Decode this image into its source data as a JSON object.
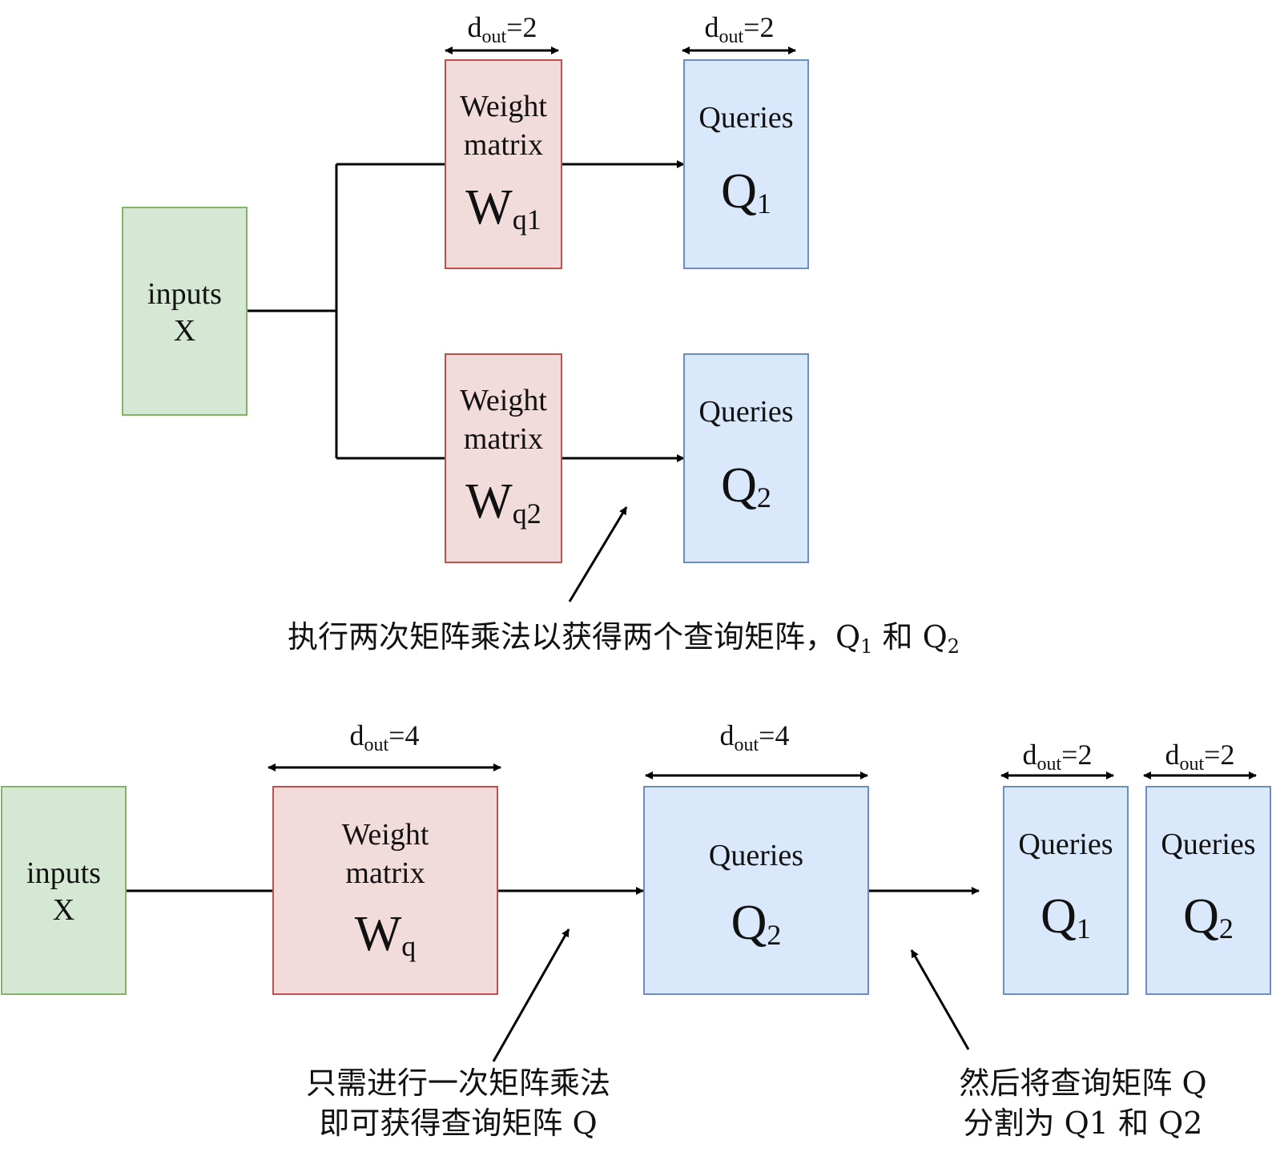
{
  "top": {
    "input": {
      "line1": "inputs",
      "line2": "X"
    },
    "weights": [
      {
        "line1": "Weight",
        "line2": "matrix",
        "symbol": "W",
        "sub": "q1",
        "dim_label": "d",
        "dim_sub": "out",
        "dim_value": "=2"
      },
      {
        "line1": "Weight",
        "line2": "matrix",
        "symbol": "W",
        "sub": "q2"
      }
    ],
    "queries": [
      {
        "label": "Queries",
        "symbol": "Q",
        "sub": "1",
        "dim_label": "d",
        "dim_sub": "out",
        "dim_value": "=2"
      },
      {
        "label": "Queries",
        "symbol": "Q",
        "sub": "2"
      }
    ],
    "caption": {
      "text": "执行两次矩阵乘法以获得两个查询矩阵，Q",
      "sub1": "1",
      "mid": " 和 Q",
      "sub2": "2"
    }
  },
  "bottom": {
    "input": {
      "line1": "inputs",
      "line2": "X"
    },
    "weight": {
      "line1": "Weight",
      "line2": "matrix",
      "symbol": "W",
      "sub": "q",
      "dim_label": "d",
      "dim_sub": "out",
      "dim_value": "=4"
    },
    "queries_big": {
      "label": "Queries",
      "symbol": "Q",
      "sub": "2",
      "dim_label": "d",
      "dim_sub": "out",
      "dim_value": "=4"
    },
    "split": [
      {
        "label": "Queries",
        "symbol": "Q",
        "sub": "1",
        "dim_label": "d",
        "dim_sub": "out",
        "dim_value": "=2"
      },
      {
        "label": "Queries",
        "symbol": "Q",
        "sub": "2",
        "dim_label": "d",
        "dim_sub": "out",
        "dim_value": "=2"
      }
    ],
    "caption_left": {
      "line1": "只需进行一次矩阵乘法",
      "line2": "即可获得查询矩阵 Q"
    },
    "caption_right": {
      "line1": "然后将查询矩阵 Q",
      "line2": "分割为 Q1 和 Q2"
    }
  }
}
